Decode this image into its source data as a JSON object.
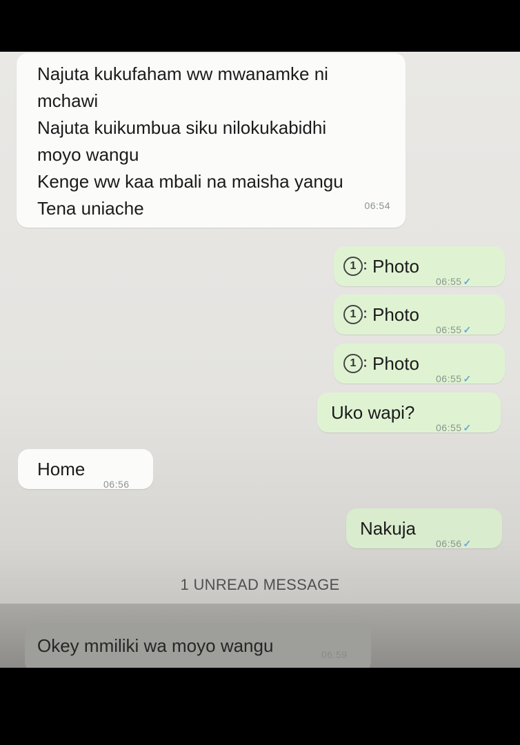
{
  "messages": [
    {
      "dir": "in",
      "text": "Najuta kukufaham ww mwanamke ni\nmchawi\nNajuta kuikumbua siku nilokukabidhi\nmoyo wangu\nKenge ww kaa mbali na maisha yangu\nTena uniache",
      "time": "06:54"
    },
    {
      "dir": "out",
      "type": "photo",
      "text": "Photo",
      "time": "06:55"
    },
    {
      "dir": "out",
      "type": "photo",
      "text": "Photo",
      "time": "06:55"
    },
    {
      "dir": "out",
      "type": "photo",
      "text": "Photo",
      "time": "06:55"
    },
    {
      "dir": "out",
      "text": "Uko wapi?",
      "time": "06:55"
    },
    {
      "dir": "in",
      "text": "Home",
      "time": "06:56"
    },
    {
      "dir": "out",
      "text": "Nakuja",
      "time": "06:56"
    }
  ],
  "photo_badge": "1",
  "unread_banner": "1 UNREAD MESSAGE",
  "last_message": {
    "text": "Okey mmiliki wa moyo wangu",
    "time": "06:59"
  },
  "colors": {
    "incoming": "#fbfbfa",
    "outgoing": "#dff3d3",
    "read_check": "#6aa6d8"
  }
}
